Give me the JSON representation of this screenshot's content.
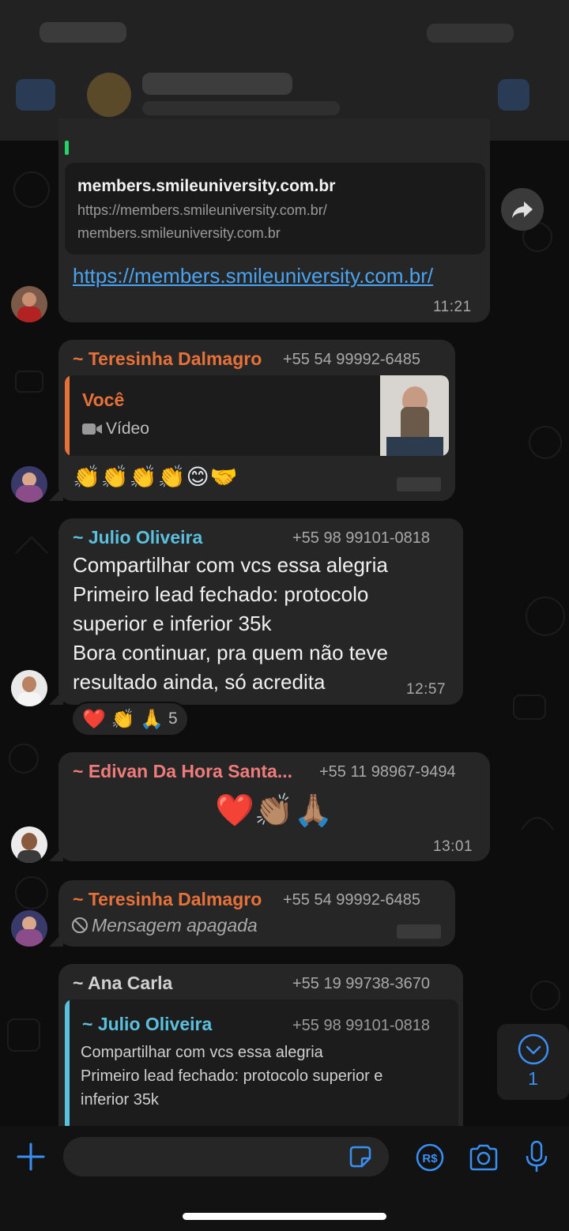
{
  "link_message": {
    "preview_title": "members.smileuniversity.com.br",
    "preview_url": "https://members.smileuniversity.com.br/",
    "preview_domain": "members.smileuniversity.com.br",
    "link_text": "https://members.smileuniversity.com.br/",
    "time": "11:21"
  },
  "message_teresinha_reply": {
    "sender": "~ Teresinha Dalmagro",
    "phone": "+55 54 99992-6485",
    "quote_author": "Você",
    "quote_type": "Vídeo",
    "emojis": "👏👏👏👏😊🤝"
  },
  "message_julio": {
    "sender": "~ Julio Oliveira",
    "phone": "+55 98 99101-0818",
    "lines": [
      "Compartilhar com vcs essa alegria",
      "Primeiro lead fechado: protocolo",
      "superior e inferior 35k",
      "Bora continuar, pra quem não teve",
      "resultado ainda, só acredita"
    ],
    "time": "12:57",
    "reactions": "❤️ 👏 🙏",
    "reaction_count": "5"
  },
  "message_edivan": {
    "sender": "~ Edivan Da Hora Santa...",
    "phone": "+55 11 98967-9494",
    "emojis": "❤️👏🏽🙏🏽",
    "time": "13:01"
  },
  "message_teresinha_deleted": {
    "sender": "~ Teresinha Dalmagro",
    "phone": "+55 54 99992-6485",
    "text": "Mensagem apagada"
  },
  "message_ana": {
    "sender": "~ Ana Carla",
    "phone": "+55 19 99738-3670",
    "quote_author": "~ Julio Oliveira",
    "quote_phone": "+55 98 99101-0818",
    "quote_lines": [
      "Compartilhar com vcs essa alegria",
      "Primeiro lead fechado: protocolo superior e",
      "inferior 35k"
    ]
  },
  "scroll_down": {
    "unread_count": "1"
  },
  "colors": {
    "accent_blue": "#3a8ff5",
    "teresinha": "#e8713a",
    "julio": "#5bc0de",
    "edivan": "#f07b7b",
    "link": "#4aa3f0",
    "green_bar": "#25d366"
  }
}
